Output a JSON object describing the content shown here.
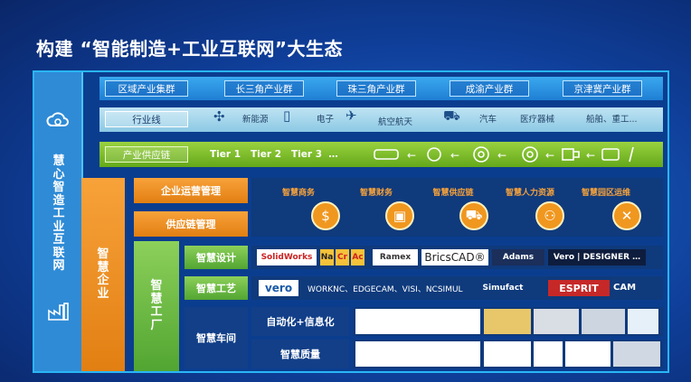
{
  "title": "构建 “智能制造+工业互联网”大生态",
  "left_column": {
    "label": "慧心智造工业互联网",
    "top_icon": "cloud-gear-icon",
    "bottom_icon": "factory-icon"
  },
  "clusters": {
    "label": "区域产业集群",
    "items": [
      "长三角产业群",
      "珠三角产业群",
      "成渝产业群",
      "京津冀产业群"
    ]
  },
  "industries": {
    "label": "行业线",
    "items": [
      {
        "name": "新能源",
        "icon": "wind-turbine-icon"
      },
      {
        "name": "电子",
        "icon": "phone-icon"
      },
      {
        "name": "航空航天",
        "icon": "airplane-icon"
      },
      {
        "name": "汽车",
        "icon": "car-icon"
      },
      {
        "name": "医疗器械",
        "icon": "medical-icon"
      },
      {
        "name": "船舶、重工...",
        "icon": "ship-icon"
      }
    ]
  },
  "supply_chain": {
    "label": "产业供应链",
    "tiers": "Tier 1   Tier 2   Tier 3  …"
  },
  "enterprise": {
    "label": "智慧企业",
    "operations_label": "企业运营管理",
    "supply_mgmt_label": "供应链管理",
    "modules": [
      "智慧商务",
      "智慧财务",
      "智慧供应链",
      "智慧人力资源",
      "智慧园区运维"
    ]
  },
  "factory": {
    "label": "智慧工厂",
    "design": {
      "label": "智慧设计",
      "logos": [
        "SolidWorks",
        "Na",
        "Cr",
        "Ac",
        "Ramex",
        "BricsCAD®",
        "Adams",
        "Vero | DESIGNER …"
      ]
    },
    "process": {
      "label": "智慧工艺",
      "vero": "vero",
      "text": "WORKNC、EDGECAM、VISI、NCSIMUL",
      "simufact": "Simufact",
      "esprit": "ESPRIT",
      "cam": "CAM"
    },
    "workshop": {
      "label": "智慧车间",
      "row1_label": "自动化+信息化",
      "row2_label": "智慧质量"
    }
  },
  "colors": {
    "orange": "#f08c1a",
    "green": "#6ab42a",
    "blue": "#2b8be0",
    "light": "#b6dff1"
  }
}
